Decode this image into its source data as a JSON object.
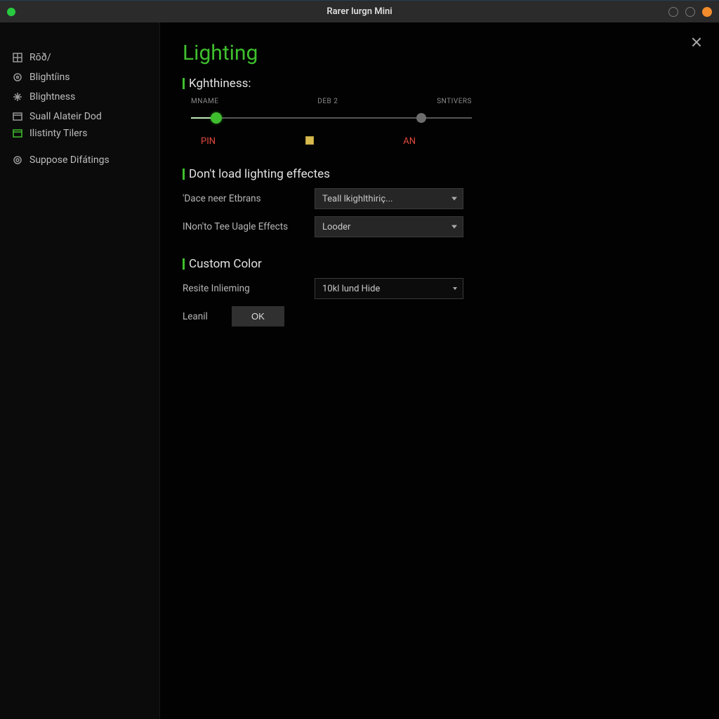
{
  "titlebar": {
    "title": "Rarer lurgn Mini"
  },
  "sidebar": {
    "items": [
      {
        "label": "Rōð/"
      },
      {
        "label": "Blightíins"
      },
      {
        "label": "Blightness"
      },
      {
        "label": "Suall Alateir Dod"
      },
      {
        "label": "Ilistinty Tilers"
      },
      {
        "label": "Suppose Difátings"
      }
    ]
  },
  "main": {
    "title": "Lighting",
    "brightness": {
      "header": "Kghthiness:",
      "tick_left": "MNAME",
      "tick_mid": "DEB 2",
      "tick_right": "SNTIVERS",
      "below_left": "PIN",
      "below_right": "AN",
      "primary_pct": 9,
      "secondary_pct": 82
    },
    "effects": {
      "header": "Don't load lighting effectes",
      "row1_label": "'Dace neer Etbrans",
      "row1_value": "Teall lkighlthiriç...",
      "row2_label": "INon'to Tee Uagle Effects",
      "row2_value": "Looder"
    },
    "custom": {
      "header": "Custom Color",
      "row1_label": "Resite Inlieming",
      "row1_value": "10kl lund Hide",
      "row2_label": "Leanil",
      "ok_label": "OK"
    }
  }
}
